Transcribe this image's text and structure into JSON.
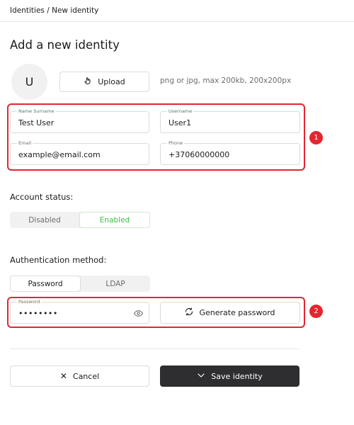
{
  "breadcrumb": "Identities / New identity",
  "title": "Add a new identity",
  "avatar": {
    "initial": "U"
  },
  "upload": {
    "label": "Upload",
    "hint": "png or jpg, max 200kb, 200x200px"
  },
  "fields": {
    "name": {
      "label": "Name Surname",
      "value": "Test User"
    },
    "username": {
      "label": "Username",
      "value": "User1"
    },
    "email": {
      "label": "Email",
      "value": "example@email.com"
    },
    "phone": {
      "label": "Phone",
      "value": "+37060000000"
    }
  },
  "markers": {
    "one": "1",
    "two": "2"
  },
  "account_status": {
    "label": "Account status:",
    "options": [
      "Disabled",
      "Enabled"
    ],
    "selected": "Enabled"
  },
  "auth": {
    "label": "Authentication method:",
    "options": [
      "Password",
      "LDAP"
    ],
    "selected": "Password"
  },
  "password": {
    "label": "Password",
    "value": "••••••••"
  },
  "buttons": {
    "generate": "Generate password",
    "cancel": "Cancel",
    "save": "Save identity"
  },
  "colors": {
    "accent_red": "#e3262f",
    "enabled_green": "#3fbf4a",
    "dark_button": "#2e2e30"
  }
}
